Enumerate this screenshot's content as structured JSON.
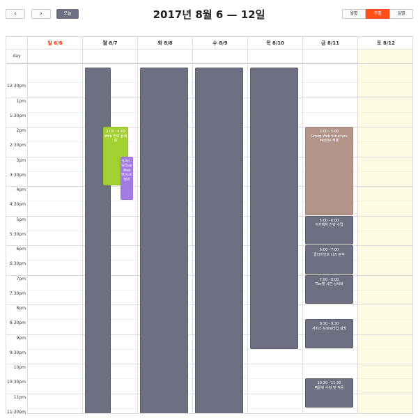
{
  "toolbar": {
    "prev_label": "‹",
    "next_label": "›",
    "today_label": "오늘",
    "title": "2017년 8월 6 — 12일",
    "views": [
      "월별",
      "주별",
      "일별"
    ],
    "active_view": "주별"
  },
  "columns": [
    {
      "label": "일 6/6",
      "color": "#ff2a00"
    },
    {
      "label": "월 8/7",
      "color": "#333333"
    },
    {
      "label": "화 8/8",
      "color": "#333333"
    },
    {
      "label": "수 8/9",
      "color": "#333333"
    },
    {
      "label": "목 8/10",
      "color": "#333333"
    },
    {
      "label": "금 8/11",
      "color": "#333333"
    },
    {
      "label": "토 8/12",
      "color": "#333333"
    }
  ],
  "allday_label": "day",
  "time_labels": [
    "12:30pm",
    "1pm",
    "1:30pm",
    "2pm",
    "2:30pm",
    "3pm",
    "3:30pm",
    "4pm",
    "4:30pm",
    "5pm",
    "5:30pm",
    "6pm",
    "6:30pm",
    "7pm",
    "7:30pm",
    "8pm",
    "8:30pm",
    "9pm",
    "9:30pm",
    "10pm",
    "10:30pm",
    "11pm",
    "11:30pm"
  ],
  "events": [
    {
      "day": 5,
      "time": "2:00 - 5:00",
      "title": "Group Web Structure Mobile 적용",
      "color": "#b3948a"
    },
    {
      "day": 5,
      "time": "5:00 - 6:00",
      "title": "아키텍처 전략 수립",
      "color": "#6c7080"
    },
    {
      "day": 5,
      "time": "6:00 - 7:00",
      "title": "클라이언트 니즈 분석",
      "color": "#6c7080"
    },
    {
      "day": 5,
      "time": "7:00 - 8:00",
      "title": "Tier별 시안 상세화",
      "color": "#6c7080"
    },
    {
      "day": 5,
      "time": "8:30 - 9:30",
      "title": "서비스 프로토타입 설명",
      "color": "#6c7080"
    },
    {
      "day": 5,
      "time": "10:30 - 11:30",
      "title": "템플릿 수정 및 적용",
      "color": "#6c7080"
    },
    {
      "day": 1,
      "time": "2:00 - 4:00",
      "title": "Web 전략 상세화",
      "color": "#a4d132"
    },
    {
      "day": 1,
      "time": "3:00 -",
      "title": "Group Web Structure 정의",
      "color": "#a27ce0"
    }
  ]
}
